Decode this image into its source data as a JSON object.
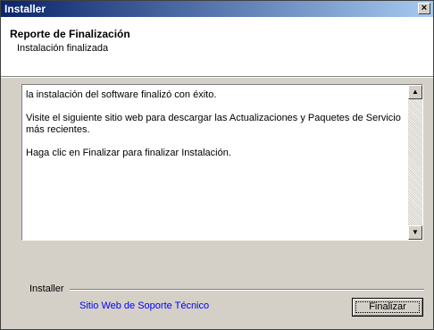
{
  "window": {
    "title": "Installer",
    "close_label": "×"
  },
  "header": {
    "title": "Reporte de Finalización",
    "subtitle": "Instalación finalizada"
  },
  "report": {
    "lines": [
      "la instalación del software finalizó con éxito.",
      "Visite el siguiente sitio web para descargar las Actualizaciones y Paquetes de Servicio más recientes.",
      "Haga clic en Finalizar para finalizar Instalación."
    ],
    "scroll_up": "▲",
    "scroll_down": "▼"
  },
  "footer": {
    "group_label": "Installer",
    "support_link": "Sitio Web de Soporte Técnico",
    "finish_label": "Finalizar"
  },
  "colors": {
    "titlebar_start": "#0a246a",
    "titlebar_end": "#a6caf0",
    "link": "#0000ff",
    "face": "#d4d0c8"
  }
}
